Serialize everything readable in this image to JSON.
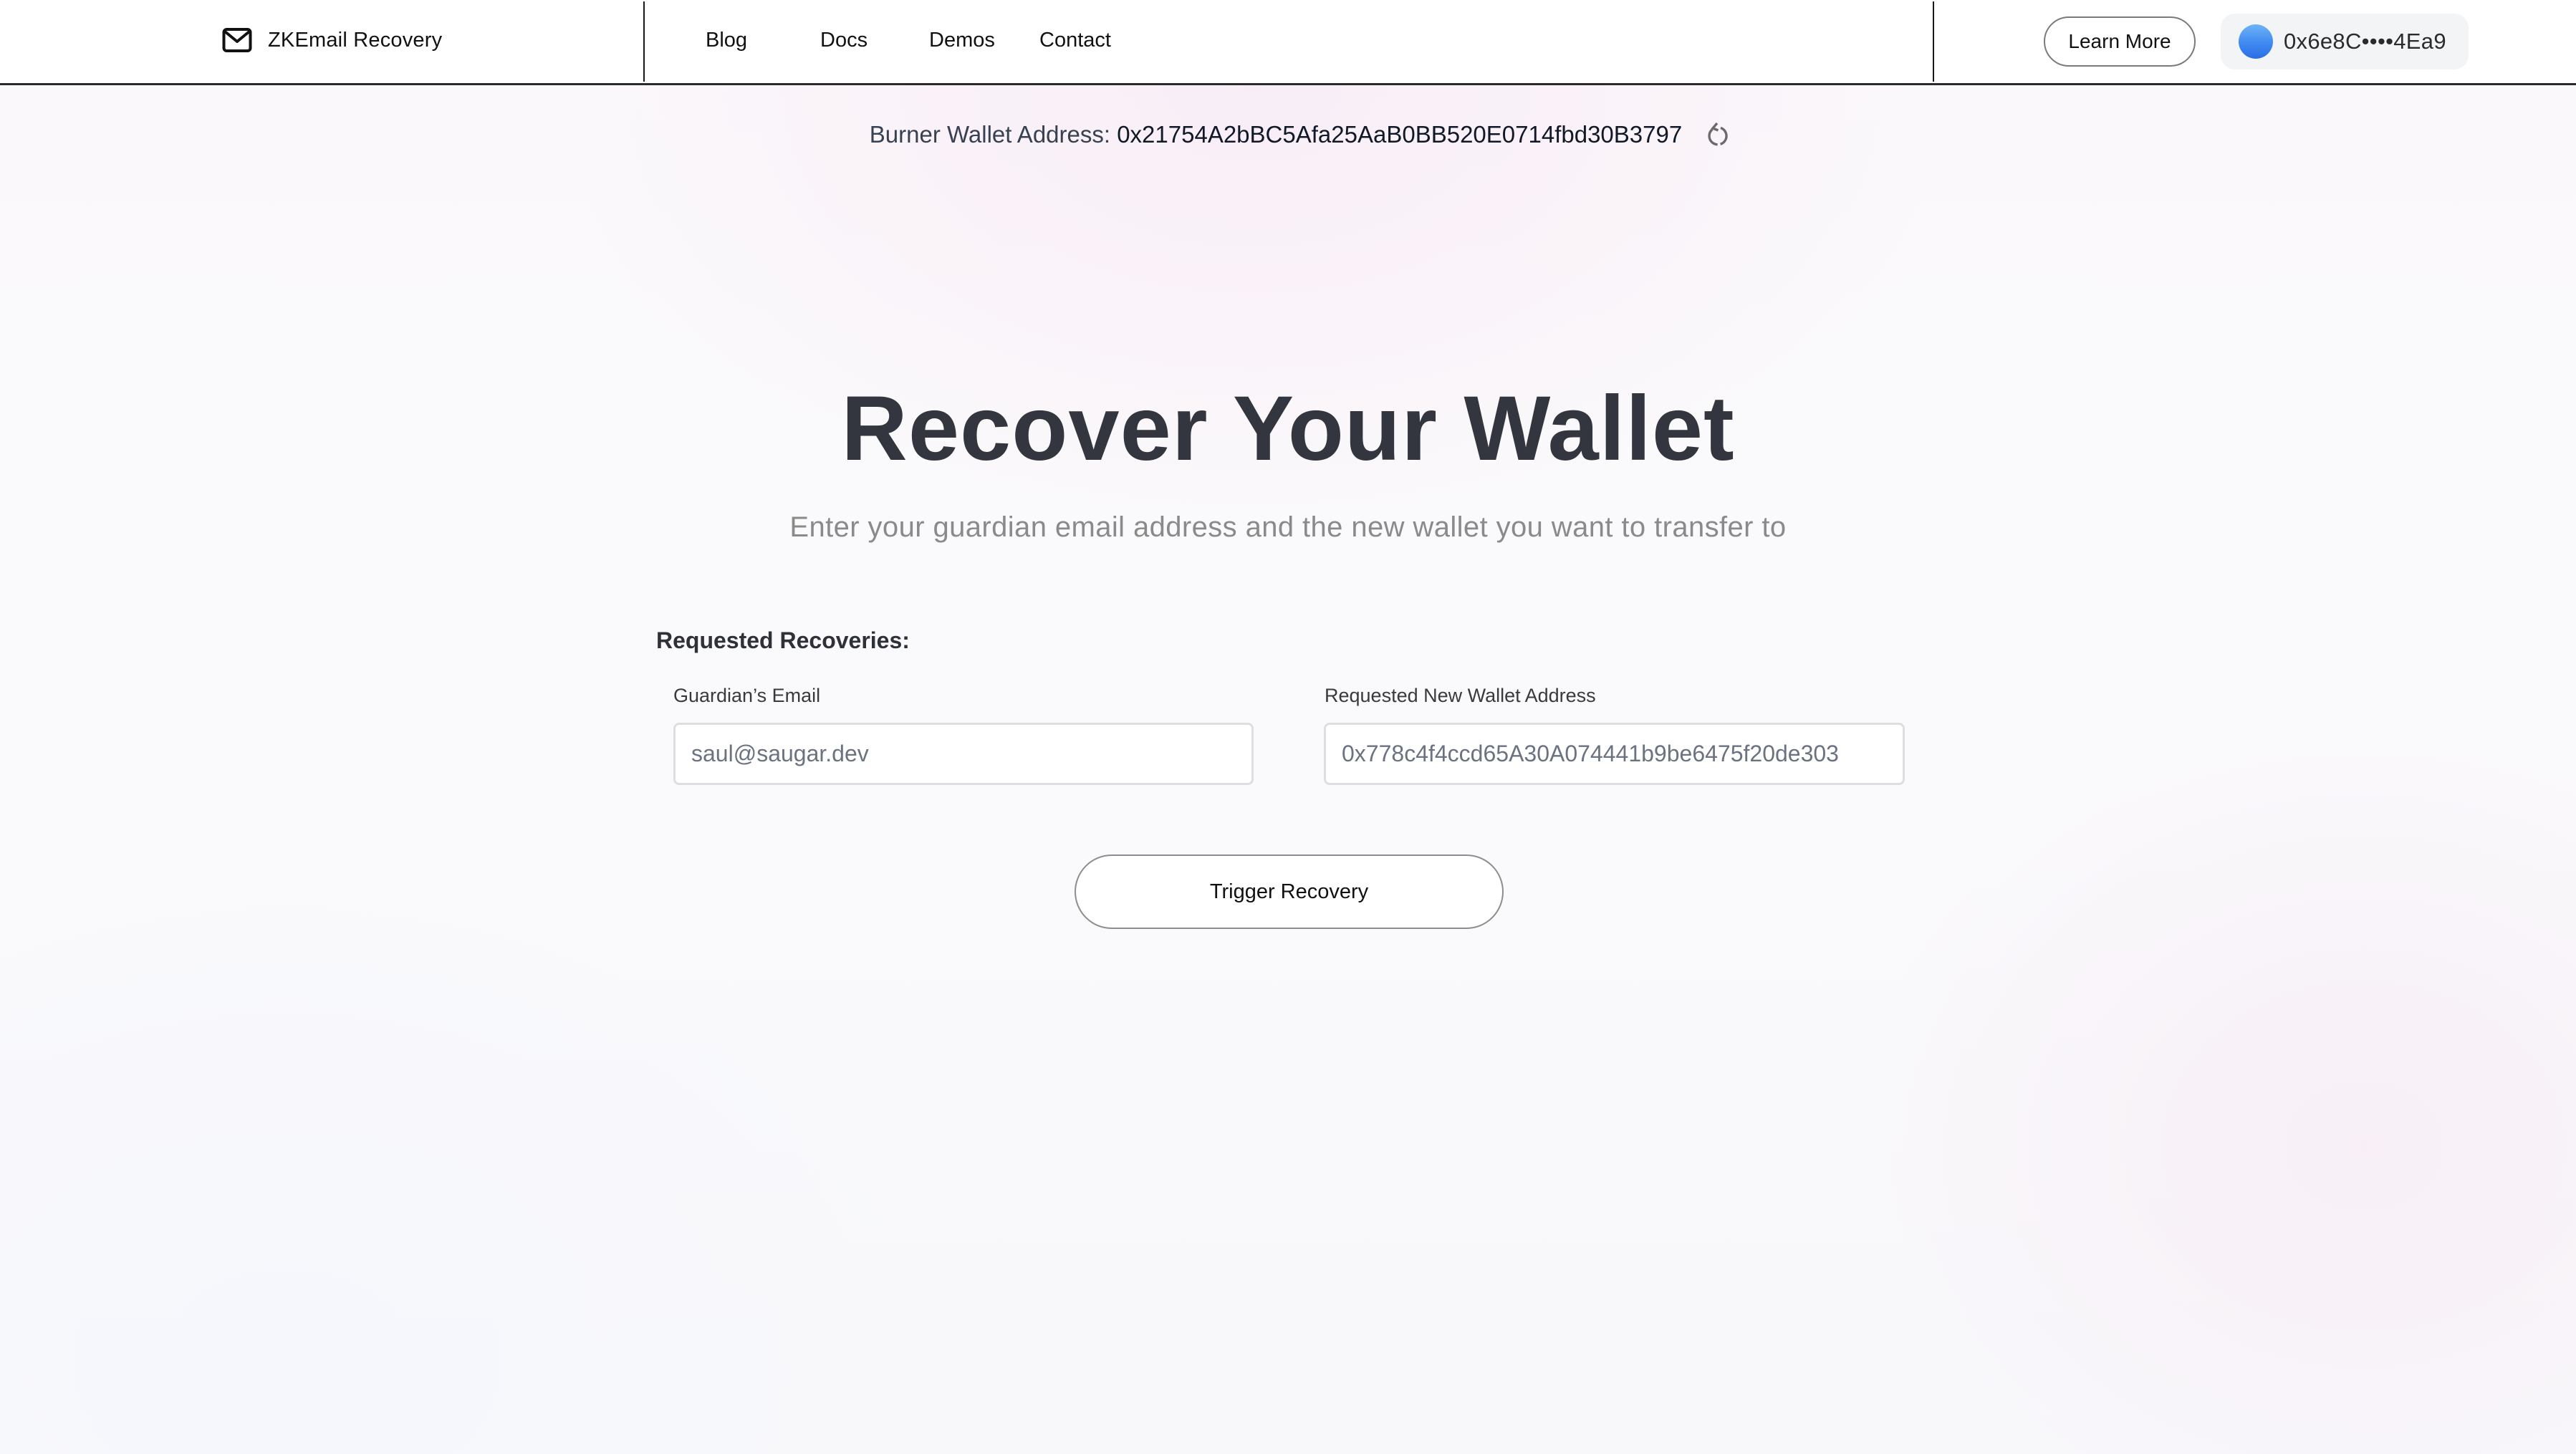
{
  "header": {
    "logo_icon": "mail-icon",
    "app_title": "ZKEmail Recovery",
    "nav": [
      {
        "label": "Blog"
      },
      {
        "label": "Docs"
      },
      {
        "label": "Demos"
      },
      {
        "label": "Contact"
      }
    ],
    "learn_more_label": "Learn More",
    "wallet": {
      "avatar_icon": "wallet-avatar-icon",
      "short_address": "0x6e8C••••4Ea9",
      "avatar_color": "#3c86f0"
    }
  },
  "burner": {
    "label": "Burner Wallet Address: ",
    "address": "0x21754A2bBC5Afa25AaB0BB520E0714fbd30B3797",
    "refresh_icon": "refresh-icon"
  },
  "main": {
    "title": "Recover Your Wallet",
    "subtitle": "Enter your guardian email address and the new wallet you want to transfer to",
    "section_heading": "Requested Recoveries:",
    "fields": {
      "guardian_email": {
        "label": "Guardian’s Email",
        "value": "saul@saugar.dev"
      },
      "new_wallet": {
        "label": "Requested New Wallet Address",
        "value": "0x778c4f4ccd65A30A074441b9be6475f20de303"
      }
    },
    "trigger_button_label": "Trigger Recovery"
  },
  "colors": {
    "title": "#33363f",
    "subtitle": "#8a8a8a",
    "input_text": "#6b7280",
    "wallet_badge_bg": "#f3f4f6"
  }
}
